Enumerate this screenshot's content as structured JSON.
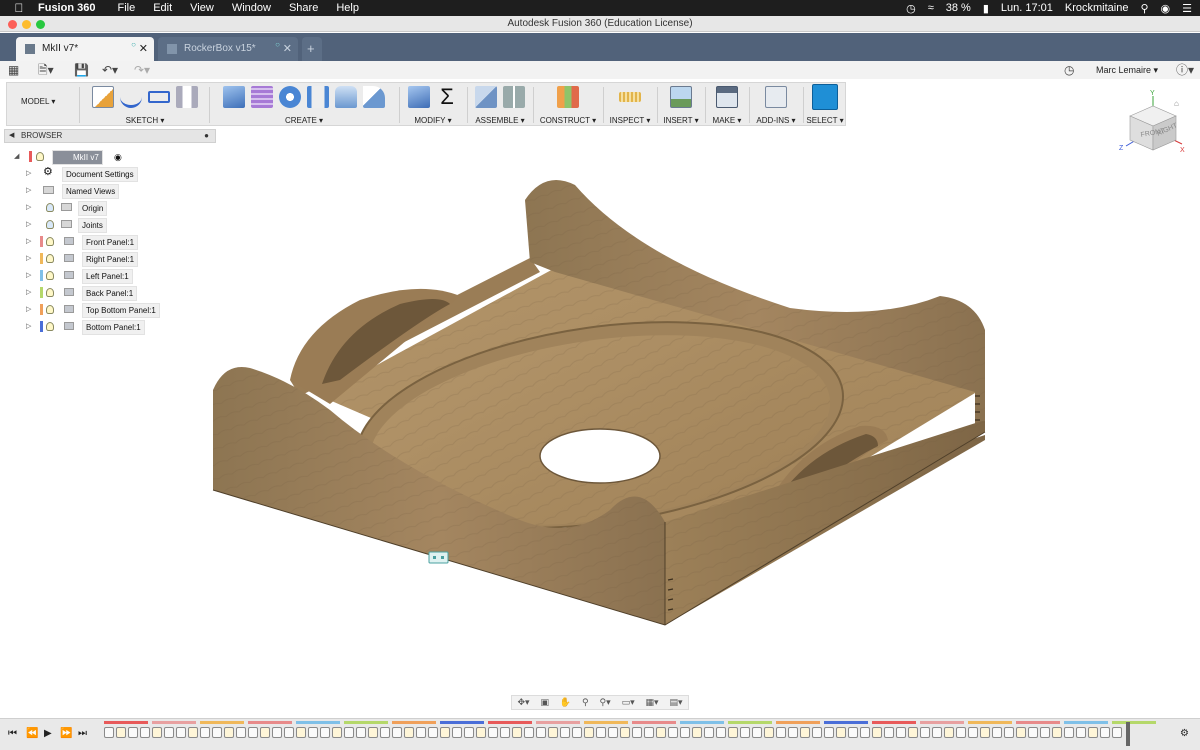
{
  "menubar": {
    "app_name": "Fusion 360",
    "menus": [
      "File",
      "Edit",
      "View",
      "Window",
      "Share",
      "Help"
    ],
    "battery": "38 %",
    "clock": "Lun. 17:01",
    "user": "Krockmitaine"
  },
  "window": {
    "title": "Autodesk Fusion 360 (Education License)"
  },
  "tabs": [
    {
      "label": "MkII v7*",
      "active": true
    },
    {
      "label": "RockerBox v15*",
      "active": false
    }
  ],
  "quick_access": {
    "user_name": "Marc Lemaire ▾"
  },
  "toolbar": {
    "workspace": "MODEL ▾",
    "groups": [
      {
        "label": "SKETCH ▾"
      },
      {
        "label": "CREATE ▾"
      },
      {
        "label": "MODIFY ▾"
      },
      {
        "label": "ASSEMBLE ▾"
      },
      {
        "label": "CONSTRUCT ▾"
      },
      {
        "label": "INSPECT ▾"
      },
      {
        "label": "INSERT ▾"
      },
      {
        "label": "MAKE ▾"
      },
      {
        "label": "ADD-INS ▾"
      },
      {
        "label": "SELECT ▾"
      }
    ]
  },
  "browser": {
    "title": "BROWSER",
    "root": "MkII v7",
    "items": [
      {
        "label": "Document Settings",
        "icon": "gear-icon"
      },
      {
        "label": "Named Views",
        "icon": "folder-icon"
      },
      {
        "label": "Origin",
        "icon": "folder-icon"
      },
      {
        "label": "Joints",
        "icon": "folder-icon"
      },
      {
        "label": "Front Panel:1",
        "icon": "body-icon",
        "color": "#e88a8a"
      },
      {
        "label": "Right Panel:1",
        "icon": "body-icon",
        "color": "#f0b85a"
      },
      {
        "label": "Left Panel:1",
        "icon": "body-icon",
        "color": "#7fc0e8"
      },
      {
        "label": "Back Panel:1",
        "icon": "body-icon",
        "color": "#b5d86a"
      },
      {
        "label": "Top Bottom Panel:1",
        "icon": "body-icon",
        "color": "#f0a05a"
      },
      {
        "label": "Bottom Panel:1",
        "icon": "body-icon",
        "color": "#4a6ed8"
      }
    ]
  },
  "viewcube": {
    "top": "TOP",
    "front": "FRONT",
    "right": "RIGHT",
    "axis_x": "X",
    "axis_y": "Y",
    "axis_z": "Z"
  },
  "colors": {
    "accent": "#1f8fd6",
    "tabbar": "#51627a",
    "wood": "#a98a5e"
  }
}
